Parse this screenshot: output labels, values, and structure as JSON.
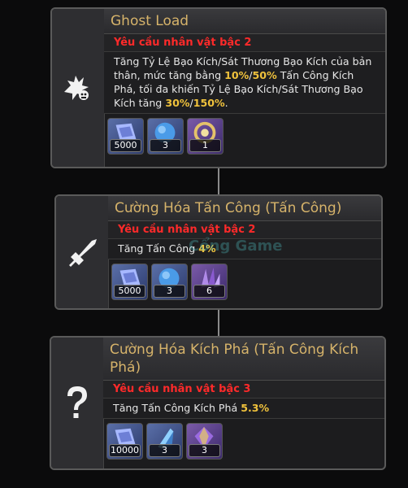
{
  "skills": [
    {
      "title": "Ghost Load",
      "requirement": "Yêu cầu nhân vật bậc 2",
      "desc_parts": [
        "Tăng Tỷ Lệ Bạo Kích/Sát Thương Bạo Kích của bản thân, mức tăng bằng ",
        "10%",
        "/",
        "50%",
        " Tấn Công Kích Phá, tối đa khiến Tỷ Lệ Bạo Kích/Sát Thương Bạo Kích tăng ",
        "30%",
        "/",
        "150%",
        "."
      ],
      "icon": "ghost-skull-icon",
      "materials": [
        {
          "icon": "blue-scroll-icon",
          "qty": "5000"
        },
        {
          "icon": "blue-orb-icon",
          "qty": "3"
        },
        {
          "icon": "gold-ring-gem-icon",
          "qty": "1"
        }
      ]
    },
    {
      "title": "Cường Hóa Tấn Công (Tấn Công)",
      "requirement": "Yêu cầu nhân vật bậc 2",
      "desc_parts": [
        "Tăng Tấn Công ",
        "4%"
      ],
      "icon": "sword-icon",
      "materials": [
        {
          "icon": "blue-scroll-icon",
          "qty": "5000"
        },
        {
          "icon": "blue-orb-icon",
          "qty": "3"
        },
        {
          "icon": "purple-crystal-icon",
          "qty": "6"
        }
      ]
    },
    {
      "title": "Cường Hóa Kích Phá (Tấn Công Kích Phá)",
      "requirement": "Yêu cầu nhân vật bậc 3",
      "desc_parts": [
        "Tăng Tấn Công Kích Phá ",
        "5.3%"
      ],
      "icon": "question-mark-icon",
      "materials": [
        {
          "icon": "blue-scroll-icon",
          "qty": "10000"
        },
        {
          "icon": "blue-crystal-shard-icon",
          "qty": "3"
        },
        {
          "icon": "purple-gold-gem-icon",
          "qty": "3"
        }
      ]
    }
  ],
  "watermark": "Cổng Game"
}
